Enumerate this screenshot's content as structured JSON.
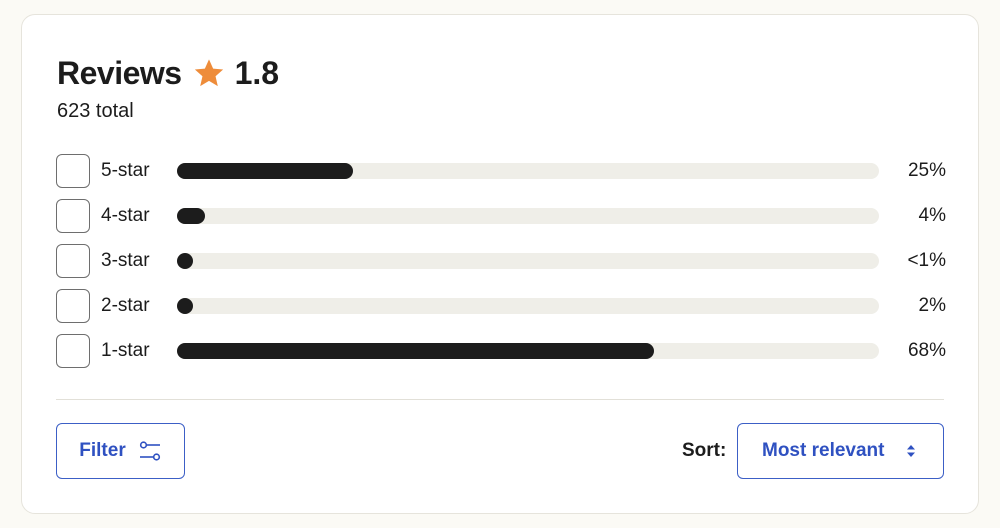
{
  "reviews": {
    "title": "Reviews",
    "rating": "1.8",
    "total": "623 total",
    "star_icon": "star-icon",
    "accent_color": "#ee8c3a"
  },
  "rows": [
    {
      "label": "5-star",
      "percent_text": "25%",
      "fill_fraction": 0.25
    },
    {
      "label": "4-star",
      "percent_text": "4%",
      "fill_fraction": 0.04
    },
    {
      "label": "3-star",
      "percent_text": "<1%",
      "fill_fraction": 0.0
    },
    {
      "label": "2-star",
      "percent_text": "2%",
      "fill_fraction": 0.0
    },
    {
      "label": "1-star",
      "percent_text": "68%",
      "fill_fraction": 0.68
    }
  ],
  "controls": {
    "filter_label": "Filter",
    "filter_icon": "sliders-icon",
    "sort_label": "Sort:",
    "sort_value": "Most relevant",
    "sort_icon": "chevron-updown-icon",
    "button_color": "#2f51c1"
  }
}
